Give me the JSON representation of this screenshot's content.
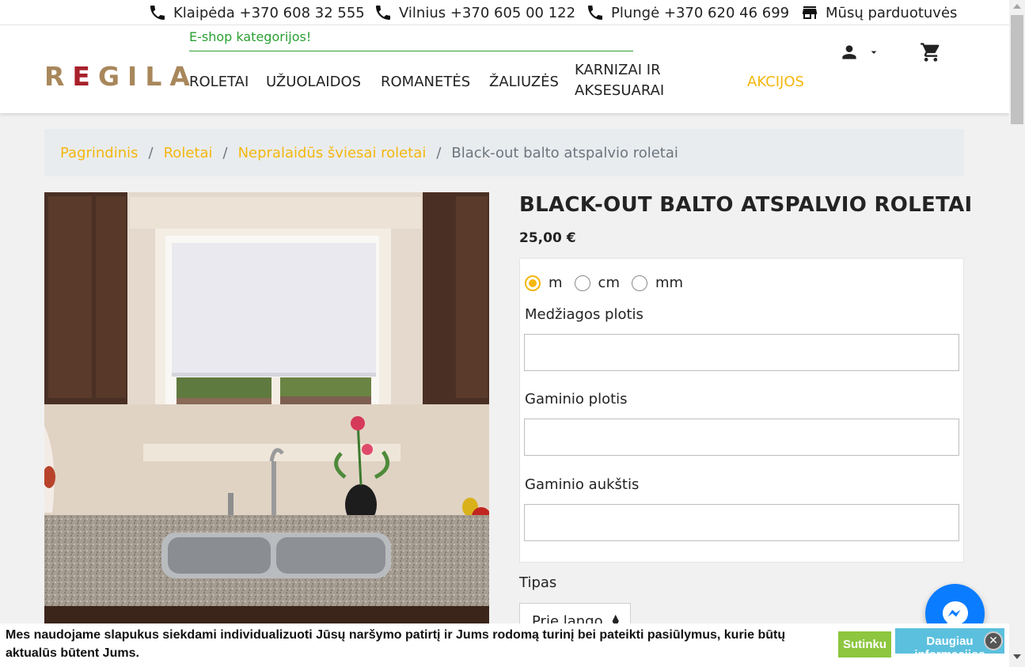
{
  "topbar": {
    "contacts": [
      {
        "icon": "phone-icon",
        "label": "Klaipėda +370 608 32 555"
      },
      {
        "icon": "phone-icon",
        "label": "Vilnius +370 605 00 122"
      },
      {
        "icon": "phone-icon",
        "label": "Plungė +370 620 46 699"
      },
      {
        "icon": "store-icon",
        "label": "Mūsų parduotuvės"
      }
    ]
  },
  "header": {
    "logo": {
      "first": "R",
      "red": "E",
      "rest": "GILA"
    },
    "eshop_label": "E-shop kategorijos!",
    "nav": [
      {
        "label": "ROLETAI"
      },
      {
        "label": "UŽUOLAIDOS"
      },
      {
        "label": "ROMANETĖS"
      },
      {
        "label": "ŽALIUZĖS"
      },
      {
        "label_line1": "KARNIZAI IR",
        "label_line2": "AKSESUARAI"
      },
      {
        "label": "AKCIJOS"
      }
    ],
    "icons": {
      "account": "user-icon",
      "account_dropdown": "caret-down-icon",
      "cart": "cart-icon"
    }
  },
  "breadcrumb": {
    "items": [
      "Pagrindinis",
      "Roletai",
      "Nepralaidūs šviesai roletai"
    ],
    "active": "Black-out balto atspalvio roletai",
    "separator": "/"
  },
  "product": {
    "title": "BLACK-OUT BALTO ATSPALVIO ROLETAI",
    "price": "25,00 €",
    "units": [
      {
        "label": "m",
        "checked": true
      },
      {
        "label": "cm",
        "checked": false
      },
      {
        "label": "mm",
        "checked": false
      }
    ],
    "fields": [
      {
        "label": "Medžiagos plotis",
        "value": ""
      },
      {
        "label": "Gaminio plotis",
        "value": ""
      },
      {
        "label": "Gaminio aukštis",
        "value": ""
      }
    ],
    "type_label": "Tipas",
    "type_value": "Prie lango"
  },
  "cookie": {
    "text": "Mes naudojame slapukus siekdami individualizuoti Jūsų naršymo patirtį ir Jums rodomą turinį bei pateikti pasiūlymus, kurie būtų aktualūs būtent Jums.",
    "accept_label": "Sutinku",
    "more_label": "Daugiau informacijos"
  },
  "colors": {
    "accent": "#f4b70e",
    "green": "#2aa033",
    "logo_gold": "#a8875b",
    "logo_red": "#a8202a",
    "messenger": "#0a7cff",
    "cookie_accept": "#8dc63f",
    "cookie_more": "#5bc0de"
  }
}
